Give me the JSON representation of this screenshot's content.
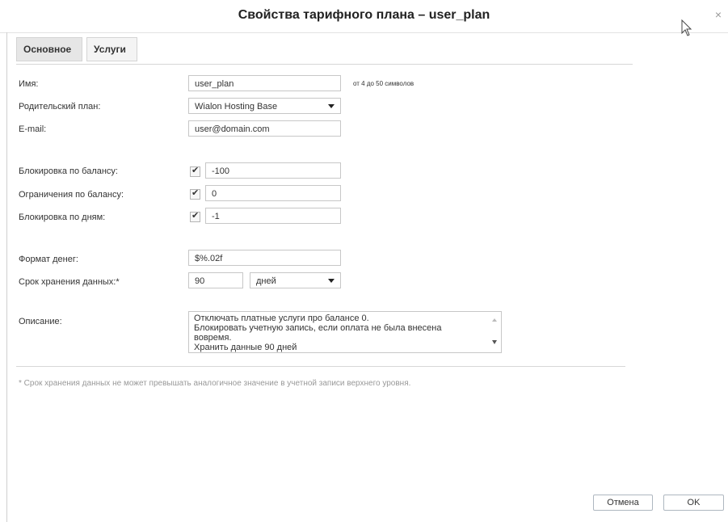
{
  "dialog": {
    "title": "Свойства тарифного плана – user_plan",
    "close_glyph": "×"
  },
  "tabs": [
    {
      "label": "Основное",
      "active": true
    },
    {
      "label": "Услуги",
      "active": false
    }
  ],
  "fields": {
    "name": {
      "label": "Имя:",
      "value": "user_plan",
      "hint": "от 4 до 50 символов"
    },
    "parent_plan": {
      "label": "Родительский план:",
      "value": "Wialon Hosting Base"
    },
    "email": {
      "label": "E-mail:",
      "value": "user@domain.com"
    },
    "balance_block": {
      "label": "Блокировка по балансу:",
      "checked": true,
      "value": "-100"
    },
    "balance_limit": {
      "label": "Ограничения по балансу:",
      "checked": true,
      "value": "0"
    },
    "days_block": {
      "label": "Блокировка по дням:",
      "checked": true,
      "value": "-1"
    },
    "money_format": {
      "label": "Формат денег:",
      "value": "$%.02f"
    },
    "retention": {
      "label": "Срок хранения данных:*",
      "value": "90",
      "unit": "дней"
    },
    "description": {
      "label": "Описание:",
      "lines": [
        "Отключать платные услуги про балансе 0.",
        "Блокировать учетную запись, если оплата не была внесена",
        "вовремя.",
        "Хранить данные 90 дней"
      ]
    }
  },
  "footnote": "* Срок хранения данных не может превышать аналогичное значение в учетной записи верхнего уровня.",
  "buttons": {
    "cancel": "Отмена",
    "ok": "OK"
  },
  "checkmark_glyph": "✔",
  "colors": {
    "border": "#c7c7c7",
    "footnote": "#999999",
    "button_border": "#aeb7c0"
  }
}
